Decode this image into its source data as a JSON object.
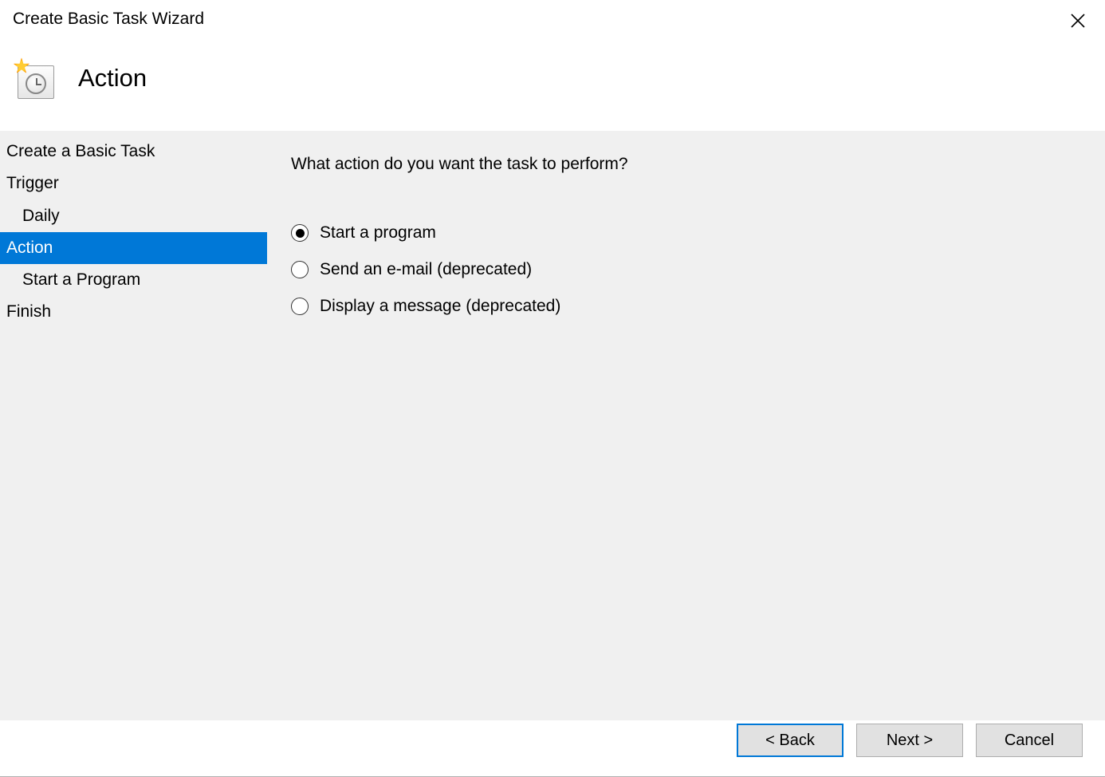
{
  "window": {
    "title": "Create Basic Task Wizard"
  },
  "header": {
    "heading": "Action"
  },
  "sidebar": {
    "items": [
      {
        "label": "Create a Basic Task",
        "indent": false,
        "selected": false
      },
      {
        "label": "Trigger",
        "indent": false,
        "selected": false
      },
      {
        "label": "Daily",
        "indent": true,
        "selected": false
      },
      {
        "label": "Action",
        "indent": false,
        "selected": true
      },
      {
        "label": "Start a Program",
        "indent": true,
        "selected": false
      },
      {
        "label": "Finish",
        "indent": false,
        "selected": false
      }
    ]
  },
  "main": {
    "prompt": "What action do you want the task to perform?",
    "options": [
      {
        "label": "Start a program",
        "checked": true
      },
      {
        "label": "Send an e-mail (deprecated)",
        "checked": false
      },
      {
        "label": "Display a message (deprecated)",
        "checked": false
      }
    ]
  },
  "buttons": {
    "back": "< Back",
    "next": "Next >",
    "cancel": "Cancel"
  }
}
